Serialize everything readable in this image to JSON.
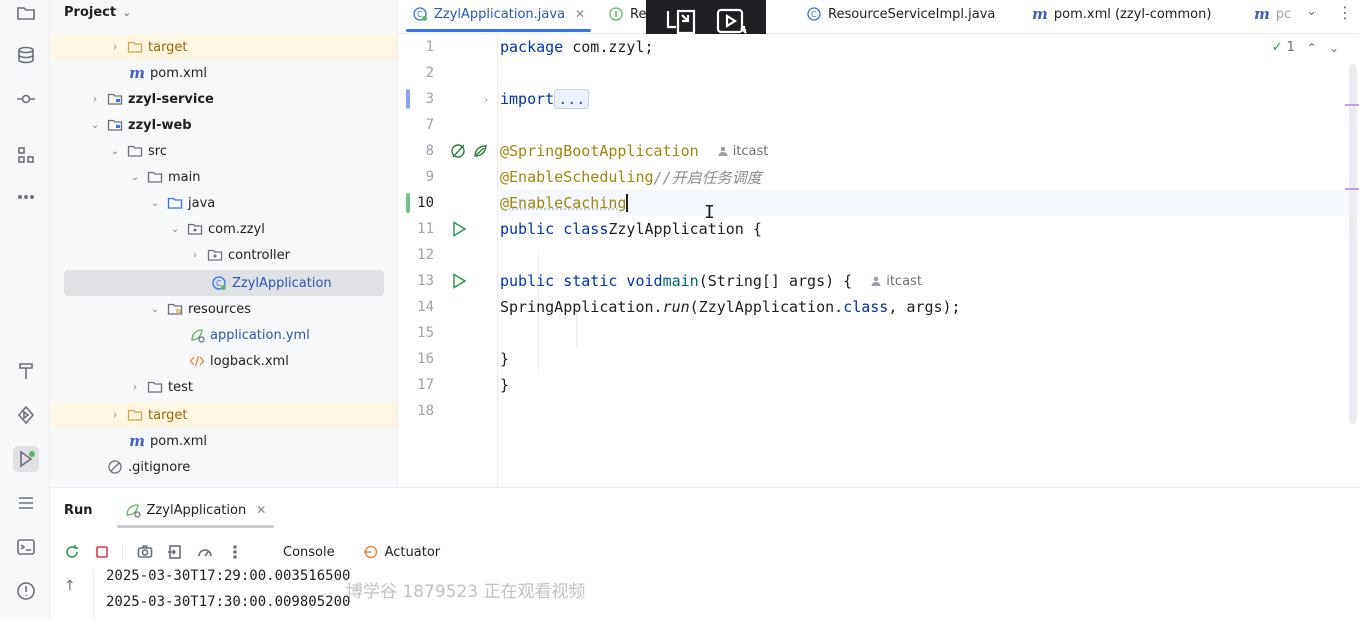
{
  "project_panel": {
    "title": "Project",
    "items": [
      {
        "label": "target",
        "kind": "folder-excluded"
      },
      {
        "label": "pom.xml",
        "kind": "maven"
      },
      {
        "label": "zzyl-service",
        "kind": "module"
      },
      {
        "label": "zzyl-web",
        "kind": "module"
      },
      {
        "label": "src",
        "kind": "folder"
      },
      {
        "label": "main",
        "kind": "folder"
      },
      {
        "label": "java",
        "kind": "source-folder"
      },
      {
        "label": "com.zzyl",
        "kind": "package"
      },
      {
        "label": "controller",
        "kind": "package"
      },
      {
        "label": "ZzylApplication",
        "kind": "spring-class"
      },
      {
        "label": "resources",
        "kind": "resources-folder"
      },
      {
        "label": "application.yml",
        "kind": "spring-config"
      },
      {
        "label": "logback.xml",
        "kind": "xml"
      },
      {
        "label": "test",
        "kind": "folder"
      },
      {
        "label": "target",
        "kind": "folder-excluded"
      },
      {
        "label": "pom.xml",
        "kind": "maven"
      },
      {
        "label": ".gitignore",
        "kind": "ignore"
      }
    ]
  },
  "tabs": [
    {
      "label": "ZzylApplication.java",
      "active": true
    },
    {
      "label": "Re"
    },
    {
      "label": "ResourceServiceImpl.java"
    },
    {
      "label": "pom.xml (zzyl-common)"
    },
    {
      "label": "pc"
    }
  ],
  "editor": {
    "line_numbers": [
      "1",
      "2",
      "3",
      "7",
      "8",
      "9",
      "10",
      "11",
      "12",
      "13",
      "14",
      "15",
      "16",
      "17",
      "18"
    ],
    "code": {
      "l1_kw": "package",
      "l1_rest": " com.zzyl;",
      "l3_kw": "import",
      "l3_fold": "...",
      "l8_ann": "@SpringBootApplication",
      "l8_author": "itcast",
      "l9_ann": "@EnableScheduling",
      "l9_comment": "//开启任务调度",
      "l10_ann": "@EnableCaching",
      "l11_kw": "public class",
      "l11_name": "ZzylApplication",
      "l11_rest": " {",
      "l13_kw": "public static void",
      "l13_fn": "main",
      "l13_rest": "(String[] args) {",
      "l13_author": "itcast",
      "l14_a": "SpringApplication.",
      "l14_it": "run",
      "l14_b": "(ZzylApplication.",
      "l14_kw": "class",
      "l14_c": ", args);",
      "l16": "}",
      "l17": "}"
    },
    "inspection_count": "1"
  },
  "run_panel": {
    "title": "Run",
    "config_tab": "ZzylApplication",
    "tabs": {
      "console": "Console",
      "actuator": "Actuator"
    },
    "log_lines": [
      "2025-03-30T17:29:00.003516500",
      "2025-03-30T17:30:00.009805200"
    ]
  },
  "watermark": "博学谷 1879523 正在观看视频",
  "colors": {
    "accent": "#3574f0",
    "keyword": "#0033b3",
    "annotation": "#9e880d",
    "comment": "#8c8c8c"
  }
}
